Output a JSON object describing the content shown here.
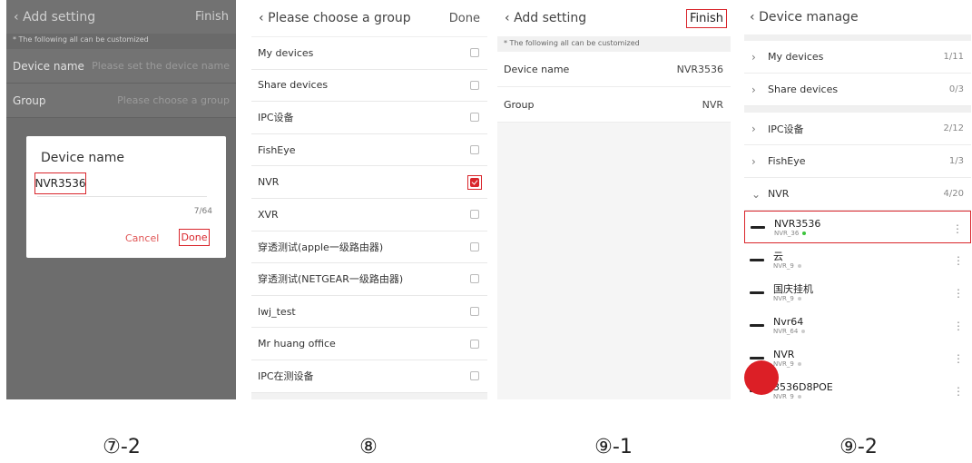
{
  "panel1": {
    "header_title": "Add setting",
    "header_action": "Finish",
    "note": "* The following all can be customized",
    "rows": [
      {
        "label": "Device name",
        "value": "Please set the device name"
      },
      {
        "label": "Group",
        "value": "Please choose a group"
      }
    ],
    "dialog": {
      "title": "Device name",
      "input_value": "NVR3536",
      "counter": "7/64",
      "cancel": "Cancel",
      "done": "Done"
    }
  },
  "panel2": {
    "header_title": "Please choose a group",
    "header_action": "Done",
    "items": [
      {
        "label": "My devices",
        "checked": false
      },
      {
        "label": "Share devices",
        "checked": false
      },
      {
        "label": "IPC设备",
        "checked": false
      },
      {
        "label": "FishEye",
        "checked": false
      },
      {
        "label": "NVR",
        "checked": true
      },
      {
        "label": "XVR",
        "checked": false
      },
      {
        "label": "穿透测试(apple一级路由器)",
        "checked": false
      },
      {
        "label": "穿透测试(NETGEAR一级路由器)",
        "checked": false
      },
      {
        "label": "lwj_test",
        "checked": false
      },
      {
        "label": "Mr huang office",
        "checked": false
      },
      {
        "label": "IPC在测设备",
        "checked": false
      }
    ]
  },
  "panel3": {
    "header_title": "Add setting",
    "header_action": "Finish",
    "note": "* The following all can be customized",
    "rows": [
      {
        "label": "Device name",
        "value": "NVR3536"
      },
      {
        "label": "Group",
        "value": "NVR"
      }
    ]
  },
  "panel4": {
    "header_title": "Device manage",
    "groups_top": [
      {
        "label": "My devices",
        "count": "1/11"
      },
      {
        "label": "Share devices",
        "count": "0/3"
      }
    ],
    "groups_mid": [
      {
        "label": "IPC设备",
        "count": "2/12"
      },
      {
        "label": "FishEye",
        "count": "1/3"
      },
      {
        "label": "NVR",
        "count": "4/20",
        "expanded": true
      }
    ],
    "devices": [
      {
        "name": "NVR3536",
        "sub": "NVR_36",
        "online": true
      },
      {
        "name": "云",
        "sub": "NVR_9",
        "online": false
      },
      {
        "name": "国庆挂机",
        "sub": "NVR_9",
        "online": false
      },
      {
        "name": "Nvr64",
        "sub": "NVR_64",
        "online": false
      },
      {
        "name": "NVR",
        "sub": "NVR_9",
        "online": false
      },
      {
        "name": "3536D8POE",
        "sub": "NVR_9",
        "online": false
      }
    ]
  },
  "captions": [
    "⑦-2",
    "⑧",
    "⑨-1",
    "⑨-2"
  ],
  "colors": {
    "highlight": "#d9252b",
    "online_dot": "#3cc43c",
    "offline_dot": "#cccccc",
    "fab": "#dc1f26"
  }
}
